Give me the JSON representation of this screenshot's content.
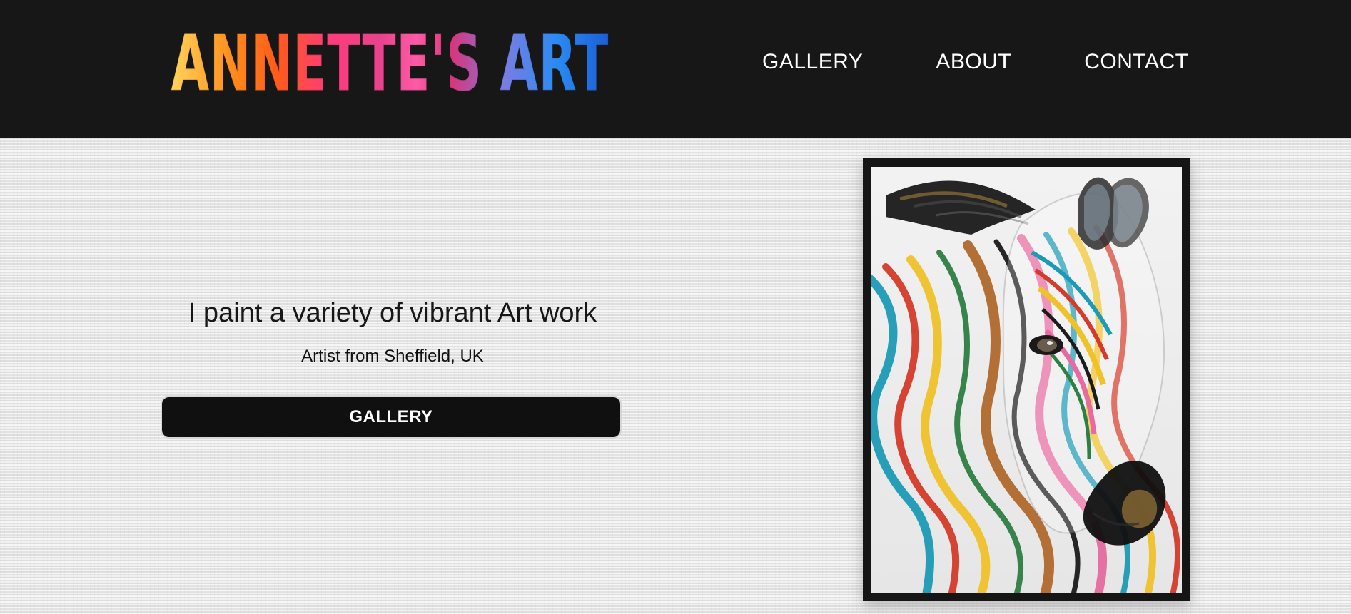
{
  "header": {
    "logo_text": "ANNETTE'S ART",
    "nav": [
      {
        "label": "GALLERY"
      },
      {
        "label": "ABOUT"
      },
      {
        "label": "CONTACT"
      }
    ],
    "background_color": "#171717"
  },
  "hero": {
    "headline": "I paint a variety of vibrant Art work",
    "subheadline": "Artist from Sheffield, UK",
    "cta_label": "GALLERY",
    "cta_background": "#101010",
    "painting": {
      "subject": "zebra",
      "style": "multicolor stripes"
    }
  }
}
